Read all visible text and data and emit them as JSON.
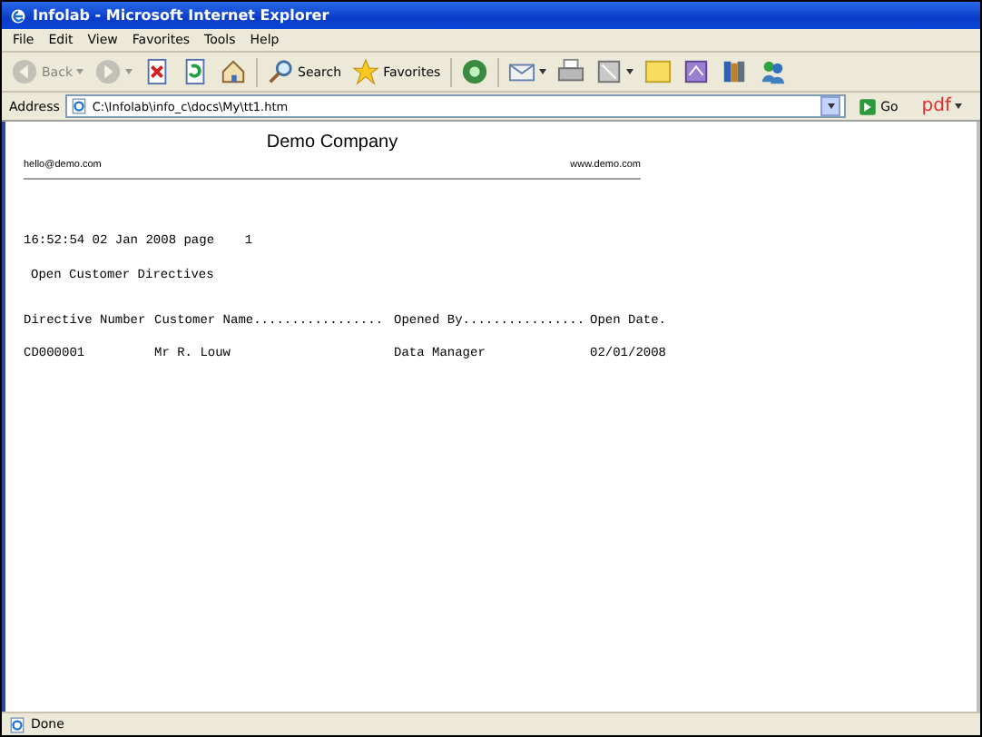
{
  "window": {
    "title": "Infolab - Microsoft Internet Explorer"
  },
  "menu": [
    "File",
    "Edit",
    "View",
    "Favorites",
    "Tools",
    "Help"
  ],
  "toolbar": [
    {
      "kind": "back",
      "label": "Back",
      "disabled": true
    },
    {
      "kind": "forward",
      "disabled": true
    },
    {
      "kind": "stop",
      "disabled": false
    },
    {
      "kind": "refresh",
      "disabled": false
    },
    {
      "kind": "home",
      "disabled": false
    },
    {
      "kind": "search",
      "label": "Search",
      "disabled": false
    },
    {
      "kind": "favorites",
      "label": "Favorites",
      "disabled": false
    },
    {
      "kind": "media",
      "disabled": false
    },
    {
      "kind": "mail",
      "disabled": false
    },
    {
      "kind": "print",
      "disabled": false
    },
    {
      "kind": "edit",
      "disabled": false
    },
    {
      "kind": "note",
      "disabled": false
    },
    {
      "kind": "research",
      "disabled": false
    },
    {
      "kind": "books",
      "disabled": false
    },
    {
      "kind": "messenger",
      "disabled": false
    }
  ],
  "address": {
    "label": "Address",
    "value": "C:\\Infolab\\info_c\\docs\\My\\tt1.htm",
    "go": "Go",
    "pdf": "pdf"
  },
  "page": {
    "company": "Demo Company",
    "email": "hello@demo.com",
    "website": "www.demo.com",
    "timestamp": "16:52:54 02 Jan 2008 page    1",
    "report_title": "Open Customer Directives",
    "columns": [
      "Directive Number",
      "Customer Name.................",
      "Opened By................",
      "Open Date."
    ],
    "rows": [
      {
        "cells": [
          "CD000001",
          "Mr R. Louw",
          "Data Manager",
          "02/01/2008"
        ]
      }
    ]
  },
  "status_bar": {
    "text": "Done"
  }
}
